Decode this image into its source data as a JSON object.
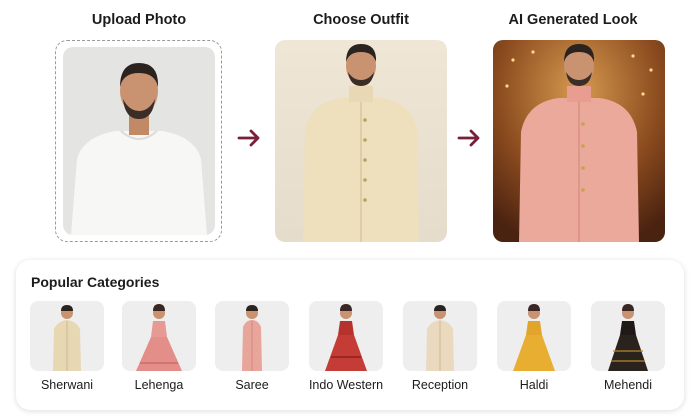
{
  "steps": {
    "upload": {
      "title": "Upload Photo"
    },
    "choose": {
      "title": "Choose Outfit"
    },
    "result": {
      "title": "AI Generated Look"
    }
  },
  "colors": {
    "arrow": "#7a1f3a",
    "upload_shirt": "#f7f7f5",
    "outfit_cream": "#eee0bc",
    "result_pink": "#eba99b"
  },
  "categories_section": {
    "heading": "Popular Categories",
    "items": [
      {
        "label": "Sherwani",
        "icon": "sherwani-thumbnail"
      },
      {
        "label": "Lehenga",
        "icon": "lehenga-thumbnail"
      },
      {
        "label": "Saree",
        "icon": "saree-thumbnail"
      },
      {
        "label": "Indo Western",
        "icon": "indo-western-thumbnail"
      },
      {
        "label": "Reception",
        "icon": "reception-thumbnail"
      },
      {
        "label": "Haldi",
        "icon": "haldi-thumbnail"
      },
      {
        "label": "Mehendi",
        "icon": "mehendi-thumbnail"
      }
    ]
  }
}
